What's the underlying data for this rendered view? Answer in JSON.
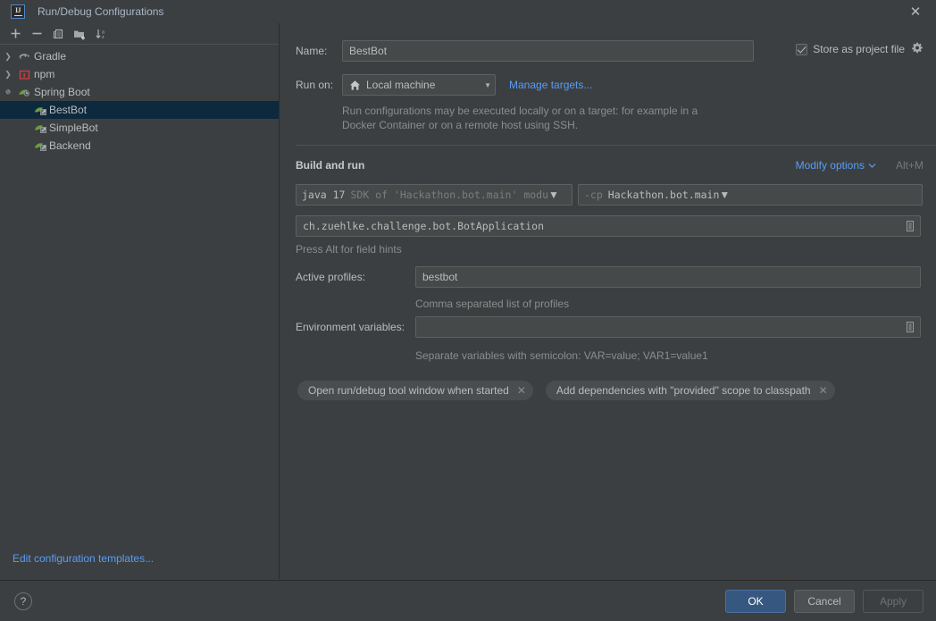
{
  "window": {
    "title": "Run/Debug Configurations",
    "logo_text": "IJ",
    "close_icon": "close-icon"
  },
  "sidebar": {
    "toolbar": [
      {
        "name": "add-configuration-button",
        "icon": "plus-icon",
        "tooltip": "Add New Configuration"
      },
      {
        "name": "remove-configuration-button",
        "icon": "minus-icon",
        "tooltip": "Remove Configuration"
      },
      {
        "name": "copy-configuration-button",
        "icon": "copy-icon",
        "tooltip": "Copy Configuration"
      },
      {
        "name": "new-folder-button",
        "icon": "new-folder-icon",
        "tooltip": "Create New Folder"
      },
      {
        "name": "sort-configurations-button",
        "icon": "sort-az-icon",
        "tooltip": "Sort Configurations"
      }
    ],
    "tree": [
      {
        "label": "Gradle",
        "icon": "gradle-elephant-icon",
        "level": 1,
        "expanded": false,
        "selected": false
      },
      {
        "label": "npm",
        "icon": "npm-icon",
        "level": 1,
        "expanded": false,
        "selected": false
      },
      {
        "label": "Spring Boot",
        "icon": "spring-boot-leaf-icon",
        "level": 1,
        "expanded": true,
        "selected": false
      },
      {
        "label": "BestBot",
        "icon": "spring-boot-run-icon",
        "level": 2,
        "selected": true
      },
      {
        "label": "SimpleBot",
        "icon": "spring-boot-run-icon",
        "level": 2,
        "selected": false
      },
      {
        "label": "Backend",
        "icon": "spring-boot-run-icon",
        "level": 2,
        "selected": false
      }
    ],
    "edit_templates_link": "Edit configuration templates..."
  },
  "form": {
    "name_label": "Name:",
    "name_value": "BestBot",
    "store_as_project_file": {
      "label": "Store as project file",
      "checked": true,
      "gear_icon": "gear-icon"
    },
    "run_on_label": "Run on:",
    "run_on_value": "Local machine",
    "run_on_icon": "home-icon",
    "manage_targets_link": "Manage targets...",
    "run_on_hint": "Run configurations may be executed locally or on a target: for example in a Docker Container or on a remote host using SSH.",
    "build_and_run_title": "Build and run",
    "modify_options_link": "Modify options",
    "modify_options_shortcut": "Alt+M",
    "sdk_combo": {
      "primary": "java 17",
      "secondary": "SDK of 'Hackathon.bot.main' modu"
    },
    "classpath_combo": {
      "prefix": "-cp",
      "value": "Hackathon.bot.main"
    },
    "main_class_value": "ch.zuehlke.challenge.bot.BotApplication",
    "main_class_expand_icon": "expand-editor-icon",
    "alt_hint": "Press Alt for field hints",
    "active_profiles_label": "Active profiles:",
    "active_profiles_value": "bestbot",
    "active_profiles_hint": "Comma separated list of profiles",
    "env_vars_label": "Environment variables:",
    "env_vars_value": "",
    "env_vars_expand_icon": "expand-editor-icon",
    "env_vars_hint": "Separate variables with semicolon: VAR=value; VAR1=value1",
    "chips": [
      {
        "label": "Open run/debug tool window when started",
        "close_icon": "close-icon"
      },
      {
        "label": "Add dependencies with \"provided\" scope to classpath",
        "close_icon": "close-icon"
      }
    ]
  },
  "footer": {
    "help_label": "?",
    "ok_label": "OK",
    "cancel_label": "Cancel",
    "apply_label": "Apply",
    "apply_enabled": false
  },
  "colors": {
    "background": "#3c3f41",
    "field_background": "#45494a",
    "selection": "#0d293e",
    "link": "#589df6",
    "primary_button": "#365880",
    "text": "#bbbbbb",
    "muted_text": "#8c8c8c"
  }
}
